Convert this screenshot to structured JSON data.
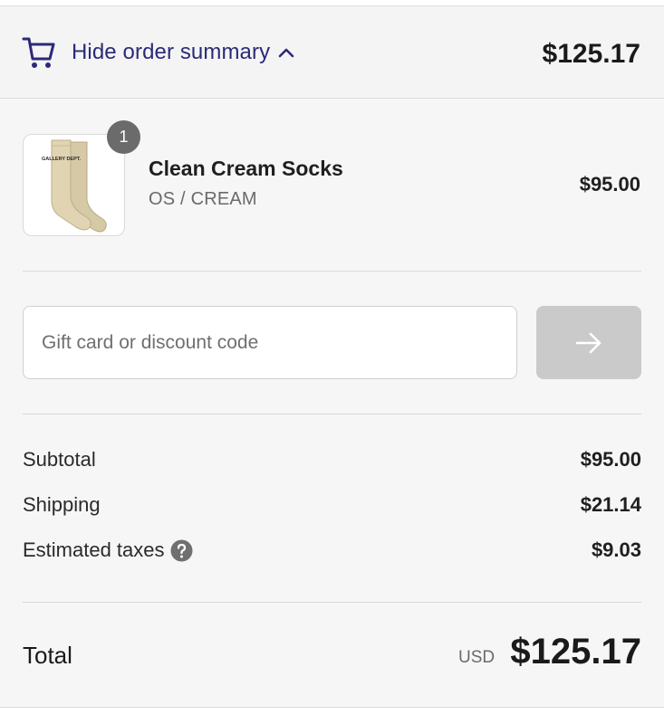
{
  "header": {
    "toggle_label": "Hide order summary",
    "total": "$125.17",
    "accent_color": "#2b2a78"
  },
  "cart": {
    "items": [
      {
        "name": "Clean Cream Socks",
        "variant": "OS / CREAM",
        "price": "$95.00",
        "quantity": "1",
        "image_text": "GALLERY DEPT."
      }
    ]
  },
  "discount": {
    "placeholder": "Gift card or discount code",
    "value": ""
  },
  "summary": {
    "subtotal_label": "Subtotal",
    "subtotal_value": "$95.00",
    "shipping_label": "Shipping",
    "shipping_value": "$21.14",
    "taxes_label": "Estimated taxes",
    "taxes_value": "$9.03",
    "total_label": "Total",
    "total_currency": "USD",
    "total_value": "$125.17"
  },
  "icons": {
    "cart": "cart-icon",
    "chevron": "chevron-up-icon",
    "apply": "arrow-right-icon",
    "help": "question-circle-icon"
  }
}
